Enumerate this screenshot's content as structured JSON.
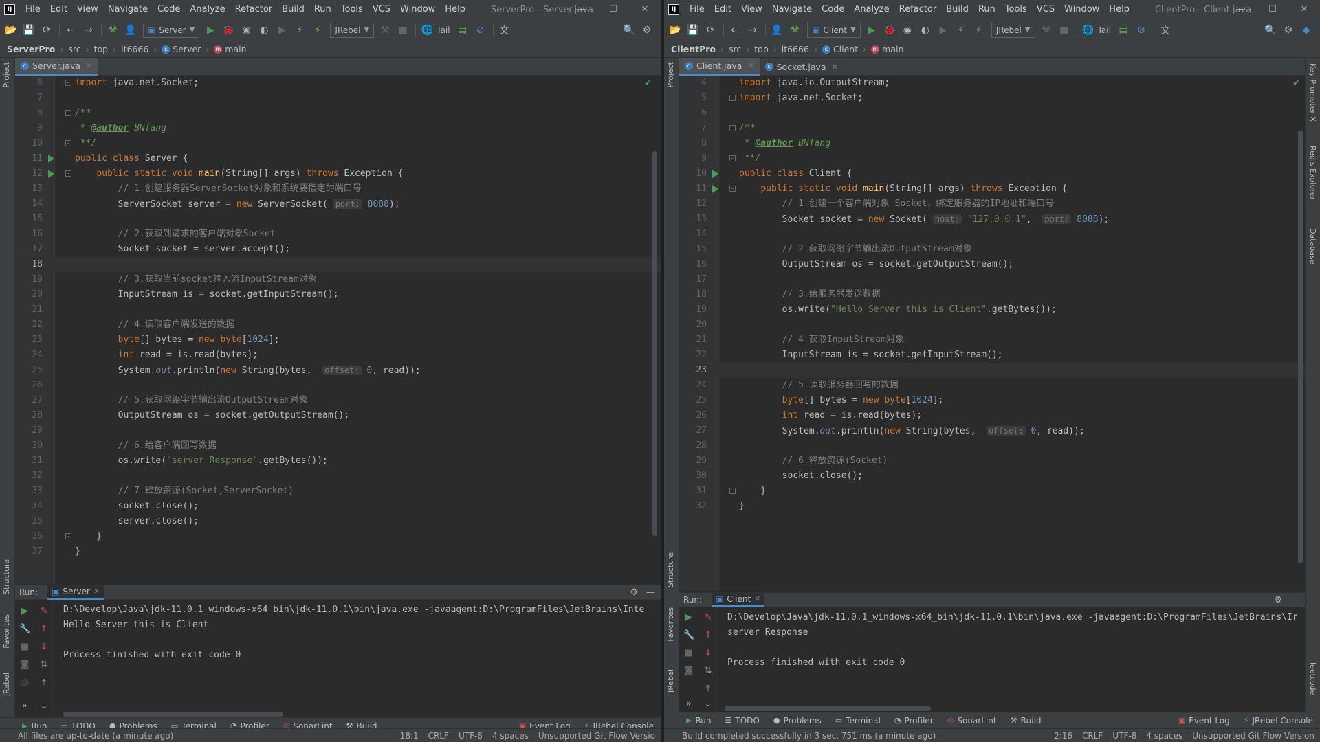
{
  "menu": [
    "File",
    "Edit",
    "View",
    "Navigate",
    "Code",
    "Analyze",
    "Refactor",
    "Build",
    "Run",
    "Tools",
    "VCS",
    "Window",
    "Help"
  ],
  "toolbar": {
    "jrebel_label": "JRebel",
    "tail_label": "Tail"
  },
  "left": {
    "window_title": "ServerPro - Server.java",
    "run_config": "Server",
    "breadcrumb": {
      "project": "ServerPro",
      "p1": "src",
      "p2": "top",
      "p3": "it6666",
      "cls": "Server",
      "method": "main"
    },
    "tabs": [
      "Server.java"
    ],
    "run_label": "Run:",
    "run_tab": "Server",
    "console": [
      "D:\\Develop\\Java\\jdk-11.0.1_windows-x64_bin\\jdk-11.0.1\\bin\\java.exe -javaagent:D:\\ProgramFiles\\JetBrains\\Inte",
      "Hello Server this is Client",
      "",
      "Process finished with exit code 0"
    ],
    "toolwindows": [
      "Run",
      "TODO",
      "Problems",
      "Terminal",
      "Profiler",
      "SonarLint",
      "Build"
    ],
    "toolwindows_right": [
      "Event Log",
      "JRebel Console"
    ],
    "status_msg": "All files are up-to-date (a minute ago)",
    "status": {
      "pos": "18:1",
      "sep": "CRLF",
      "enc": "UTF-8",
      "indent": "4 spaces",
      "git": "Unsupported Git Flow Versio"
    }
  },
  "right": {
    "window_title": "ClientPro - Client.java",
    "run_config": "Client",
    "breadcrumb": {
      "project": "ClientPro",
      "p1": "src",
      "p2": "top",
      "p3": "it6666",
      "cls": "Client",
      "method": "main"
    },
    "tabs": [
      "Client.java",
      "Socket.java"
    ],
    "run_label": "Run:",
    "run_tab": "Client",
    "console": [
      "D:\\Develop\\Java\\jdk-11.0.1_windows-x64_bin\\jdk-11.0.1\\bin\\java.exe -javaagent:D:\\ProgramFiles\\JetBrains\\Ir",
      "server Response",
      "",
      "Process finished with exit code 0"
    ],
    "toolwindows": [
      "Run",
      "TODO",
      "Problems",
      "Terminal",
      "Profiler",
      "SonarLint",
      "Build"
    ],
    "toolwindows_right": [
      "Event Log",
      "JRebel Console"
    ],
    "status_msg": "Build completed successfully in 3 sec, 751 ms (a minute ago)",
    "status": {
      "pos": "2:16",
      "sep": "CRLF",
      "enc": "UTF-8",
      "indent": "4 spaces",
      "git": "Unsupported Git Flow Version"
    }
  },
  "side_labels": {
    "project": "Project",
    "structure": "Structure",
    "favorites": "Favorites",
    "jrebel": "JRebel",
    "key_promoter": "Key Promoter X",
    "redis": "Redis Explorer",
    "database": "Database",
    "leetcode": "leetcode"
  },
  "code": {
    "left": [
      {
        "n": 6,
        "t": [
          [
            "kw",
            "import "
          ],
          [
            "p",
            "java.net.Socket;"
          ]
        ]
      },
      {
        "n": 7,
        "t": []
      },
      {
        "n": 8,
        "t": [
          [
            "doc",
            "/**"
          ]
        ]
      },
      {
        "n": 9,
        "t": [
          [
            "doc",
            " * "
          ],
          [
            "tag",
            "@author"
          ],
          [
            "doc",
            " BNTang"
          ]
        ]
      },
      {
        "n": 10,
        "t": [
          [
            "doc",
            " **/"
          ]
        ]
      },
      {
        "n": 11,
        "t": [
          [
            "kw",
            "public class "
          ],
          [
            "p",
            "Server {"
          ]
        ]
      },
      {
        "n": 12,
        "t": [
          [
            "p",
            "    "
          ],
          [
            "kw",
            "public static void "
          ],
          [
            "fn",
            "main"
          ],
          [
            "p",
            "(String[] args) "
          ],
          [
            "kw",
            "throws "
          ],
          [
            "p",
            "Exception {"
          ]
        ]
      },
      {
        "n": 13,
        "t": [
          [
            "cm",
            "        // 1.创建服务器ServerSocket对象和系统要指定的端口号"
          ]
        ]
      },
      {
        "n": 14,
        "t": [
          [
            "p",
            "        ServerSocket server = "
          ],
          [
            "kw",
            "new "
          ],
          [
            "p",
            "ServerSocket( "
          ],
          [
            "hint",
            "port:"
          ],
          [
            "num",
            " 8088"
          ],
          [
            "p",
            ");"
          ]
        ]
      },
      {
        "n": 15,
        "t": []
      },
      {
        "n": 16,
        "t": [
          [
            "cm",
            "        // 2.获取到请求的客户端对象Socket"
          ]
        ]
      },
      {
        "n": 17,
        "t": [
          [
            "p",
            "        Socket socket = server.accept();"
          ]
        ]
      },
      {
        "n": 18,
        "t": []
      },
      {
        "n": 19,
        "t": [
          [
            "cm",
            "        // 3.获取当前socket输入流InputStream对象"
          ]
        ]
      },
      {
        "n": 20,
        "t": [
          [
            "p",
            "        InputStream is = socket.getInputStream();"
          ]
        ]
      },
      {
        "n": 21,
        "t": []
      },
      {
        "n": 22,
        "t": [
          [
            "cm",
            "        // 4.读取客户端发送的数据"
          ]
        ]
      },
      {
        "n": 23,
        "t": [
          [
            "p",
            "        "
          ],
          [
            "kw",
            "byte"
          ],
          [
            "p",
            "[] bytes = "
          ],
          [
            "kw",
            "new byte"
          ],
          [
            "p",
            "["
          ],
          [
            "num",
            "1024"
          ],
          [
            "p",
            "];"
          ]
        ]
      },
      {
        "n": 24,
        "t": [
          [
            "p",
            "        "
          ],
          [
            "kw",
            "int "
          ],
          [
            "p",
            "read = is.read(bytes);"
          ]
        ]
      },
      {
        "n": 25,
        "t": [
          [
            "p",
            "        System."
          ],
          [
            "st",
            "out"
          ],
          [
            "p",
            ".println("
          ],
          [
            "kw",
            "new "
          ],
          [
            "p",
            "String(bytes,  "
          ],
          [
            "hint",
            "offset:"
          ],
          [
            "num",
            " 0"
          ],
          [
            "p",
            ", read));"
          ]
        ]
      },
      {
        "n": 26,
        "t": []
      },
      {
        "n": 27,
        "t": [
          [
            "cm",
            "        // 5.获取网络字节输出流OutputStream对象"
          ]
        ]
      },
      {
        "n": 28,
        "t": [
          [
            "p",
            "        OutputStream os = socket.getOutputStream();"
          ]
        ]
      },
      {
        "n": 29,
        "t": []
      },
      {
        "n": 30,
        "t": [
          [
            "cm",
            "        // 6.给客户端回写数据"
          ]
        ]
      },
      {
        "n": 31,
        "t": [
          [
            "p",
            "        os.write("
          ],
          [
            "str",
            "\"server Response\""
          ],
          [
            "p",
            ".getBytes());"
          ]
        ]
      },
      {
        "n": 32,
        "t": []
      },
      {
        "n": 33,
        "t": [
          [
            "cm",
            "        // 7.释放资源(Socket,ServerSocket)"
          ]
        ]
      },
      {
        "n": 34,
        "t": [
          [
            "p",
            "        socket.close();"
          ]
        ]
      },
      {
        "n": 35,
        "t": [
          [
            "p",
            "        server.close();"
          ]
        ]
      },
      {
        "n": 36,
        "t": [
          [
            "p",
            "    }"
          ]
        ]
      },
      {
        "n": 37,
        "t": [
          [
            "p",
            "}"
          ]
        ]
      }
    ],
    "right": [
      {
        "n": 4,
        "t": [
          [
            "kw",
            "import "
          ],
          [
            "p",
            "java.io.OutputStream;"
          ]
        ]
      },
      {
        "n": 5,
        "t": [
          [
            "kw",
            "import "
          ],
          [
            "p",
            "java.net.Socket;"
          ]
        ]
      },
      {
        "n": 6,
        "t": []
      },
      {
        "n": 7,
        "t": [
          [
            "doc",
            "/**"
          ]
        ]
      },
      {
        "n": 8,
        "t": [
          [
            "doc",
            " * "
          ],
          [
            "tag",
            "@author"
          ],
          [
            "doc",
            " BNTang"
          ]
        ]
      },
      {
        "n": 9,
        "t": [
          [
            "doc",
            " **/"
          ]
        ]
      },
      {
        "n": 10,
        "t": [
          [
            "kw",
            "public class "
          ],
          [
            "p",
            "Client {"
          ]
        ]
      },
      {
        "n": 11,
        "t": [
          [
            "p",
            "    "
          ],
          [
            "kw",
            "public static void "
          ],
          [
            "fn",
            "main"
          ],
          [
            "p",
            "(String[] args) "
          ],
          [
            "kw",
            "throws "
          ],
          [
            "p",
            "Exception {"
          ]
        ]
      },
      {
        "n": 12,
        "t": [
          [
            "cm",
            "        // 1.创建一个客户端对象 Socket，绑定服务器的IP地址和端口号"
          ]
        ]
      },
      {
        "n": 13,
        "t": [
          [
            "p",
            "        Socket socket = "
          ],
          [
            "kw",
            "new "
          ],
          [
            "p",
            "Socket( "
          ],
          [
            "hint",
            "host:"
          ],
          [
            "str",
            " \"127.0.0.1\""
          ],
          [
            "p",
            ",  "
          ],
          [
            "hint",
            "port:"
          ],
          [
            "num",
            " 8088"
          ],
          [
            "p",
            ");"
          ]
        ]
      },
      {
        "n": 14,
        "t": []
      },
      {
        "n": 15,
        "t": [
          [
            "cm",
            "        // 2.获取网络字节输出流OutputStream对象"
          ]
        ]
      },
      {
        "n": 16,
        "t": [
          [
            "p",
            "        OutputStream os = socket.getOutputStream();"
          ]
        ]
      },
      {
        "n": 17,
        "t": []
      },
      {
        "n": 18,
        "t": [
          [
            "cm",
            "        // 3.给服务器发送数据"
          ]
        ]
      },
      {
        "n": 19,
        "t": [
          [
            "p",
            "        os.write("
          ],
          [
            "str",
            "\"Hello Server this is Client\""
          ],
          [
            "p",
            ".getBytes());"
          ]
        ]
      },
      {
        "n": 20,
        "t": []
      },
      {
        "n": 21,
        "t": [
          [
            "cm",
            "        // 4.获取InputStream对象"
          ]
        ]
      },
      {
        "n": 22,
        "t": [
          [
            "p",
            "        InputStream is = socket.getInputStream();"
          ]
        ]
      },
      {
        "n": 23,
        "t": []
      },
      {
        "n": 24,
        "t": [
          [
            "cm",
            "        // 5.读取服务器回写的数据"
          ]
        ]
      },
      {
        "n": 25,
        "t": [
          [
            "p",
            "        "
          ],
          [
            "kw",
            "byte"
          ],
          [
            "p",
            "[] bytes = "
          ],
          [
            "kw",
            "new byte"
          ],
          [
            "p",
            "["
          ],
          [
            "num",
            "1024"
          ],
          [
            "p",
            "];"
          ]
        ]
      },
      {
        "n": 26,
        "t": [
          [
            "p",
            "        "
          ],
          [
            "kw",
            "int "
          ],
          [
            "p",
            "read = is.read(bytes);"
          ]
        ]
      },
      {
        "n": 27,
        "t": [
          [
            "p",
            "        System."
          ],
          [
            "st",
            "out"
          ],
          [
            "p",
            ".println("
          ],
          [
            "kw",
            "new "
          ],
          [
            "p",
            "String(bytes,  "
          ],
          [
            "hint",
            "offset:"
          ],
          [
            "num",
            " 0"
          ],
          [
            "p",
            ", read));"
          ]
        ]
      },
      {
        "n": 28,
        "t": []
      },
      {
        "n": 29,
        "t": [
          [
            "cm",
            "        // 6.释放资源(Socket)"
          ]
        ]
      },
      {
        "n": 30,
        "t": [
          [
            "p",
            "        socket.close();"
          ]
        ]
      },
      {
        "n": 31,
        "t": [
          [
            "p",
            "    }"
          ]
        ]
      },
      {
        "n": 32,
        "t": [
          [
            "p",
            "}"
          ]
        ]
      }
    ]
  }
}
